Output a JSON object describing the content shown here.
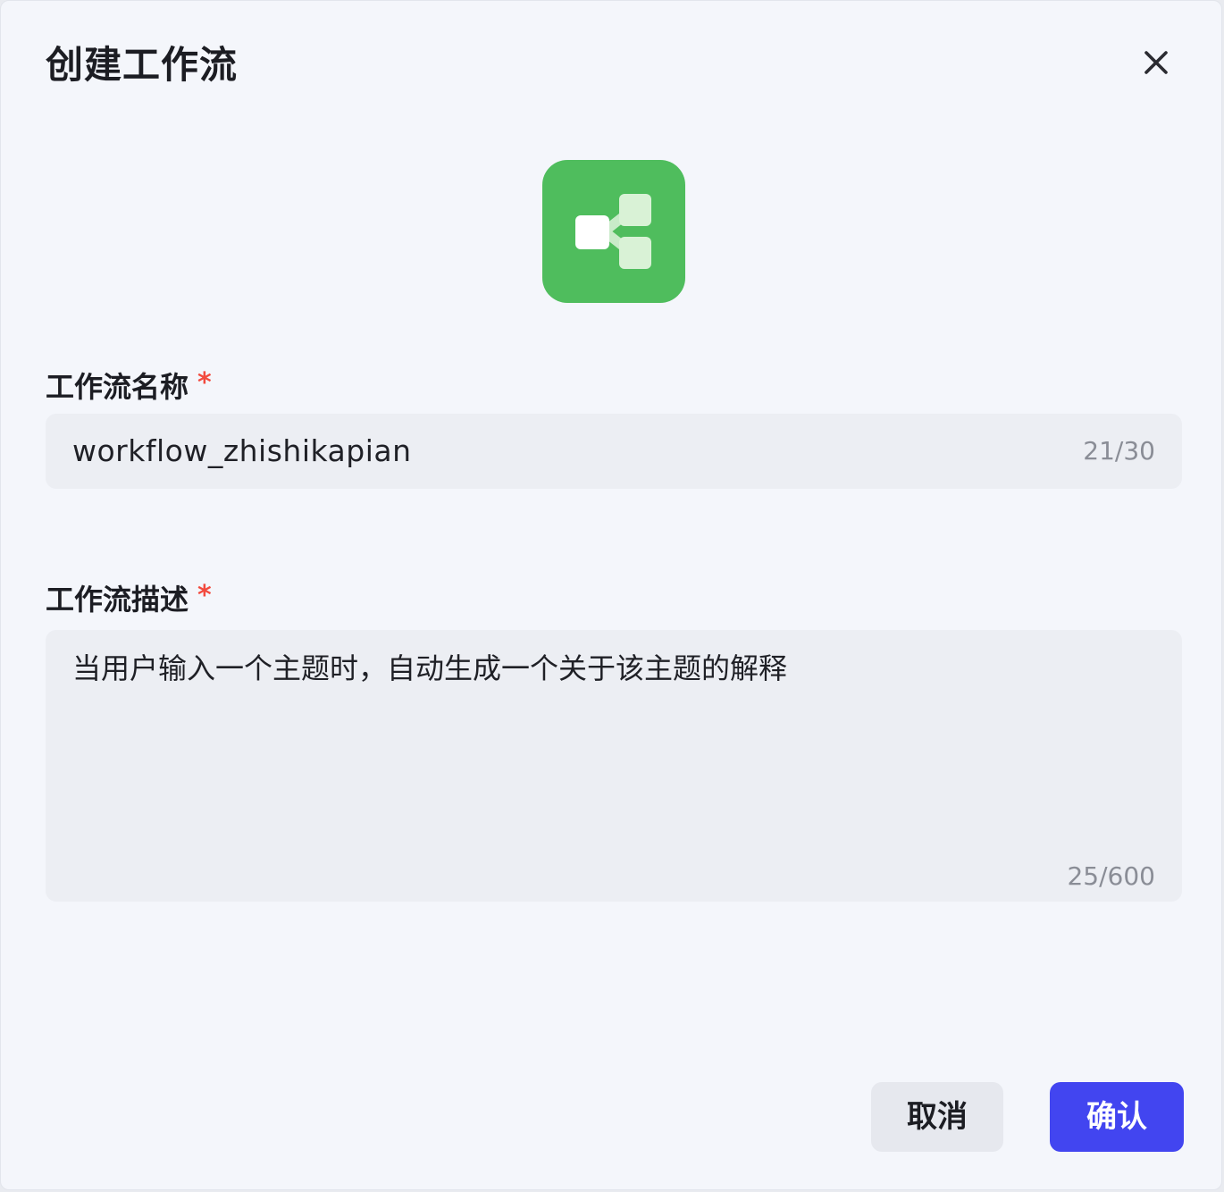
{
  "dialog": {
    "title": "创建工作流",
    "close_icon": "close-icon",
    "app_icon": "workflow-icon",
    "accent_color": "#4fbd5d"
  },
  "name_field": {
    "label": "工作流名称",
    "required_mark": "*",
    "value": "workflow_zhishikapian",
    "counter": "21/30"
  },
  "description_field": {
    "label": "工作流描述",
    "required_mark": "*",
    "value": "当用户输入一个主题时，自动生成一个关于该主题的解释",
    "counter": "25/600"
  },
  "buttons": {
    "cancel_label": "取消",
    "confirm_label": "确认",
    "confirm_color": "#4245f0"
  }
}
